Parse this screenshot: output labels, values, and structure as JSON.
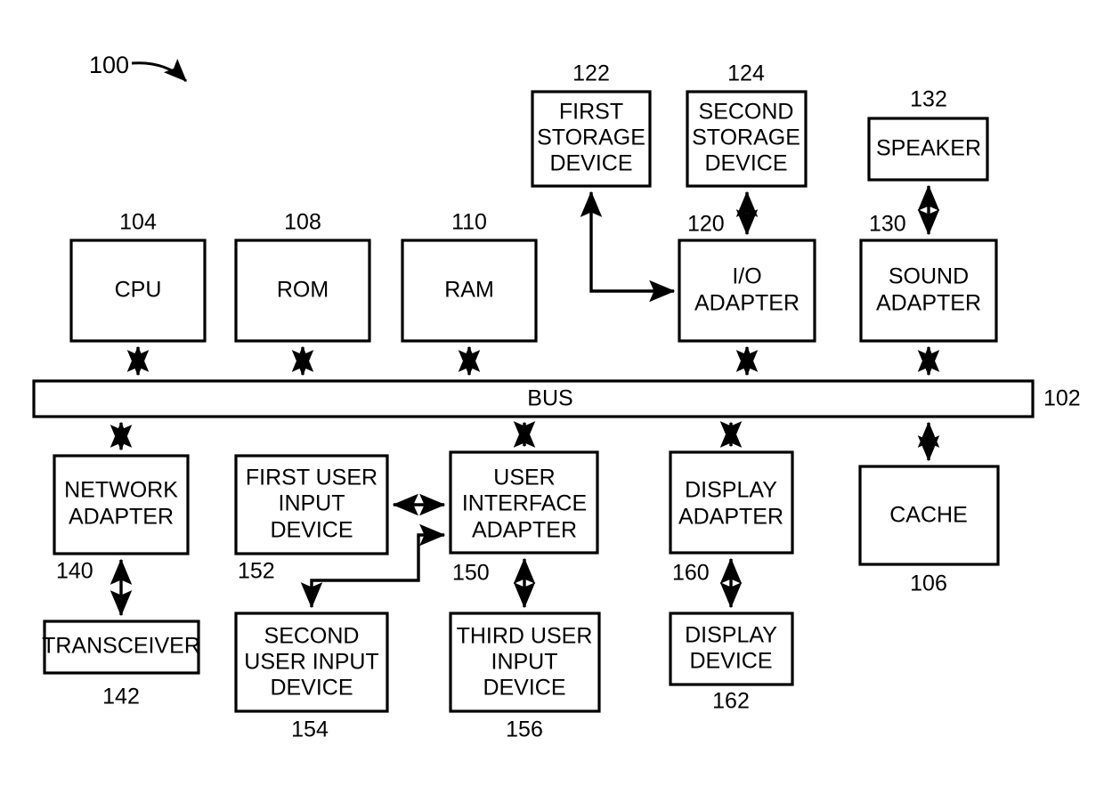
{
  "figure": {
    "figure_number": "100",
    "background_color": "#ffffff",
    "line_color": "#000000",
    "title": "Computer system block diagram"
  },
  "blocks": [
    {
      "id": "first-storage-device",
      "ref": "122",
      "lines": [
        "FIRST",
        "STORAGE",
        "DEVICE"
      ],
      "ref_position": "above-center"
    },
    {
      "id": "second-storage-device",
      "ref": "124",
      "lines": [
        "SECOND",
        "STORAGE",
        "DEVICE"
      ],
      "ref_position": "above-center"
    },
    {
      "id": "speaker",
      "ref": "132",
      "lines": [
        "SPEAKER"
      ],
      "ref_position": "above-center"
    },
    {
      "id": "cpu",
      "ref": "104",
      "lines": [
        "CPU"
      ],
      "ref_position": "above-center"
    },
    {
      "id": "rom",
      "ref": "108",
      "lines": [
        "ROM"
      ],
      "ref_position": "above-center"
    },
    {
      "id": "ram",
      "ref": "110",
      "lines": [
        "RAM"
      ],
      "ref_position": "above-center"
    },
    {
      "id": "io-adapter",
      "ref": "120",
      "lines": [
        "I/O",
        "ADAPTER"
      ],
      "ref_position": "above-left"
    },
    {
      "id": "sound-adapter",
      "ref": "130",
      "lines": [
        "SOUND",
        "ADAPTER"
      ],
      "ref_position": "above-left"
    },
    {
      "id": "bus",
      "ref": "102",
      "lines": [
        "BUS"
      ],
      "ref_position": "right"
    },
    {
      "id": "network-adapter",
      "ref": "140",
      "lines": [
        "NETWORK",
        "ADAPTER"
      ],
      "ref_position": "below-left"
    },
    {
      "id": "first-user-input-device",
      "ref": "152",
      "lines": [
        "FIRST USER",
        "INPUT",
        "DEVICE"
      ],
      "ref_position": "below-left"
    },
    {
      "id": "user-interface-adapter",
      "ref": "150",
      "lines": [
        "USER",
        "INTERFACE",
        "ADAPTER"
      ],
      "ref_position": "below-left"
    },
    {
      "id": "display-adapter",
      "ref": "160",
      "lines": [
        "DISPLAY",
        "ADAPTER"
      ],
      "ref_position": "below-left"
    },
    {
      "id": "cache",
      "ref": "106",
      "lines": [
        "CACHE"
      ],
      "ref_position": "below-center"
    },
    {
      "id": "transceiver",
      "ref": "142",
      "lines": [
        "TRANSCEIVER"
      ],
      "ref_position": "below-center"
    },
    {
      "id": "second-user-input-device",
      "ref": "154",
      "lines": [
        "SECOND",
        "USER INPUT",
        "DEVICE"
      ],
      "ref_position": "below-center"
    },
    {
      "id": "third-user-input-device",
      "ref": "156",
      "lines": [
        "THIRD USER",
        "INPUT",
        "DEVICE"
      ],
      "ref_position": "below-center"
    },
    {
      "id": "display-device",
      "ref": "162",
      "lines": [
        "DISPLAY",
        "DEVICE"
      ],
      "ref_position": "below-center"
    }
  ],
  "labels": {
    "figure_number": "100",
    "first_storage_device": "FIRST\nSTORAGE\nDEVICE",
    "first_storage_line1": "FIRST",
    "first_storage_line2": "STORAGE",
    "first_storage_line3": "DEVICE",
    "first_storage_ref": "122",
    "second_storage_line1": "SECOND",
    "second_storage_line2": "STORAGE",
    "second_storage_line3": "DEVICE",
    "second_storage_ref": "124",
    "speaker_line1": "SPEAKER",
    "speaker_ref": "132",
    "cpu_line1": "CPU",
    "cpu_ref": "104",
    "rom_line1": "ROM",
    "rom_ref": "108",
    "ram_line1": "RAM",
    "ram_ref": "110",
    "io_adapter_line1": "I/O",
    "io_adapter_line2": "ADAPTER",
    "io_adapter_ref": "120",
    "sound_adapter_line1": "SOUND",
    "sound_adapter_line2": "ADAPTER",
    "sound_adapter_ref": "130",
    "bus_line1": "BUS",
    "bus_ref": "102",
    "network_adapter_line1": "NETWORK",
    "network_adapter_line2": "ADAPTER",
    "network_adapter_ref": "140",
    "first_user_input_line1": "FIRST USER",
    "first_user_input_line2": "INPUT",
    "first_user_input_line3": "DEVICE",
    "first_user_input_ref": "152",
    "user_interface_line1": "USER",
    "user_interface_line2": "INTERFACE",
    "user_interface_line3": "ADAPTER",
    "user_interface_ref": "150",
    "display_adapter_line1": "DISPLAY",
    "display_adapter_line2": "ADAPTER",
    "display_adapter_ref": "160",
    "cache_line1": "CACHE",
    "cache_ref": "106",
    "transceiver_line1": "TRANSCEIVER",
    "transceiver_ref": "142",
    "second_user_input_line1": "SECOND",
    "second_user_input_line2": "USER INPUT",
    "second_user_input_line3": "DEVICE",
    "second_user_input_ref": "154",
    "third_user_input_line1": "THIRD USER",
    "third_user_input_line2": "INPUT",
    "third_user_input_line3": "DEVICE",
    "third_user_input_ref": "156",
    "display_device_line1": "DISPLAY",
    "display_device_line2": "DEVICE",
    "display_device_ref": "162"
  },
  "connections": [
    {
      "from": "io-adapter",
      "to": "first-storage-device",
      "style": "elbow",
      "arrows": "both"
    },
    {
      "from": "io-adapter",
      "to": "second-storage-device",
      "style": "straight-vertical",
      "arrows": "both"
    },
    {
      "from": "sound-adapter",
      "to": "speaker",
      "style": "straight-vertical",
      "arrows": "both"
    },
    {
      "from": "cpu",
      "to": "bus",
      "style": "straight-vertical",
      "arrows": "both"
    },
    {
      "from": "rom",
      "to": "bus",
      "style": "straight-vertical",
      "arrows": "both"
    },
    {
      "from": "ram",
      "to": "bus",
      "style": "straight-vertical",
      "arrows": "both"
    },
    {
      "from": "io-adapter",
      "to": "bus",
      "style": "straight-vertical",
      "arrows": "both"
    },
    {
      "from": "sound-adapter",
      "to": "bus",
      "style": "straight-vertical",
      "arrows": "both"
    },
    {
      "from": "bus",
      "to": "network-adapter",
      "style": "straight-vertical",
      "arrows": "both"
    },
    {
      "from": "bus",
      "to": "user-interface-adapter",
      "style": "straight-vertical",
      "arrows": "both"
    },
    {
      "from": "bus",
      "to": "display-adapter",
      "style": "straight-vertical",
      "arrows": "both"
    },
    {
      "from": "bus",
      "to": "cache",
      "style": "straight-vertical",
      "arrows": "both"
    },
    {
      "from": "network-adapter",
      "to": "transceiver",
      "style": "straight-vertical",
      "arrows": "both"
    },
    {
      "from": "first-user-input-device",
      "to": "user-interface-adapter",
      "style": "straight-horizontal",
      "arrows": "both"
    },
    {
      "from": "user-interface-adapter",
      "to": "second-user-input-device",
      "style": "z-elbow",
      "arrows": "both"
    },
    {
      "from": "user-interface-adapter",
      "to": "third-user-input-device",
      "style": "straight-vertical",
      "arrows": "both"
    },
    {
      "from": "display-adapter",
      "to": "display-device",
      "style": "straight-vertical",
      "arrows": "both"
    }
  ]
}
